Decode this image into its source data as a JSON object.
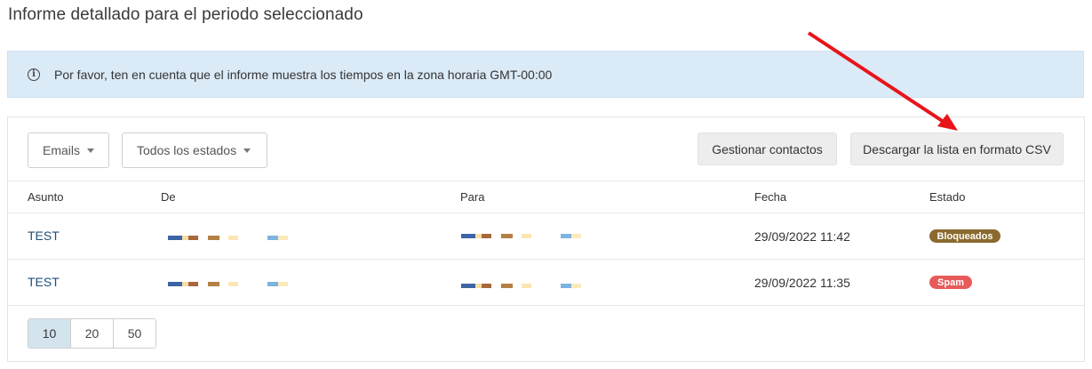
{
  "page": {
    "title": "Informe detallado para el periodo seleccionado"
  },
  "banner": {
    "icon": "info-icon",
    "text": "Por favor, ten en cuenta que el informe muestra los tiempos en la zona horaria GMT-00:00"
  },
  "toolbar": {
    "filter_type": "Emails",
    "filter_status": "Todos los estados",
    "manage_contacts": "Gestionar contactos",
    "download_csv": "Descargar la lista en formato CSV"
  },
  "table": {
    "headers": {
      "subject": "Asunto",
      "from": "De",
      "to": "Para",
      "date": "Fecha",
      "status": "Estado"
    },
    "rows": [
      {
        "subject": "TEST",
        "date": "29/09/2022 11:42",
        "status": "Bloqueados",
        "status_color": "#8a6a2e"
      },
      {
        "subject": "TEST",
        "date": "29/09/2022 11:35",
        "status": "Spam",
        "status_color": "#e85a5a"
      }
    ]
  },
  "pagination": {
    "options": [
      "10",
      "20",
      "50"
    ],
    "selected": "10"
  },
  "annotation": {
    "arrow_color": "#e8141a"
  }
}
